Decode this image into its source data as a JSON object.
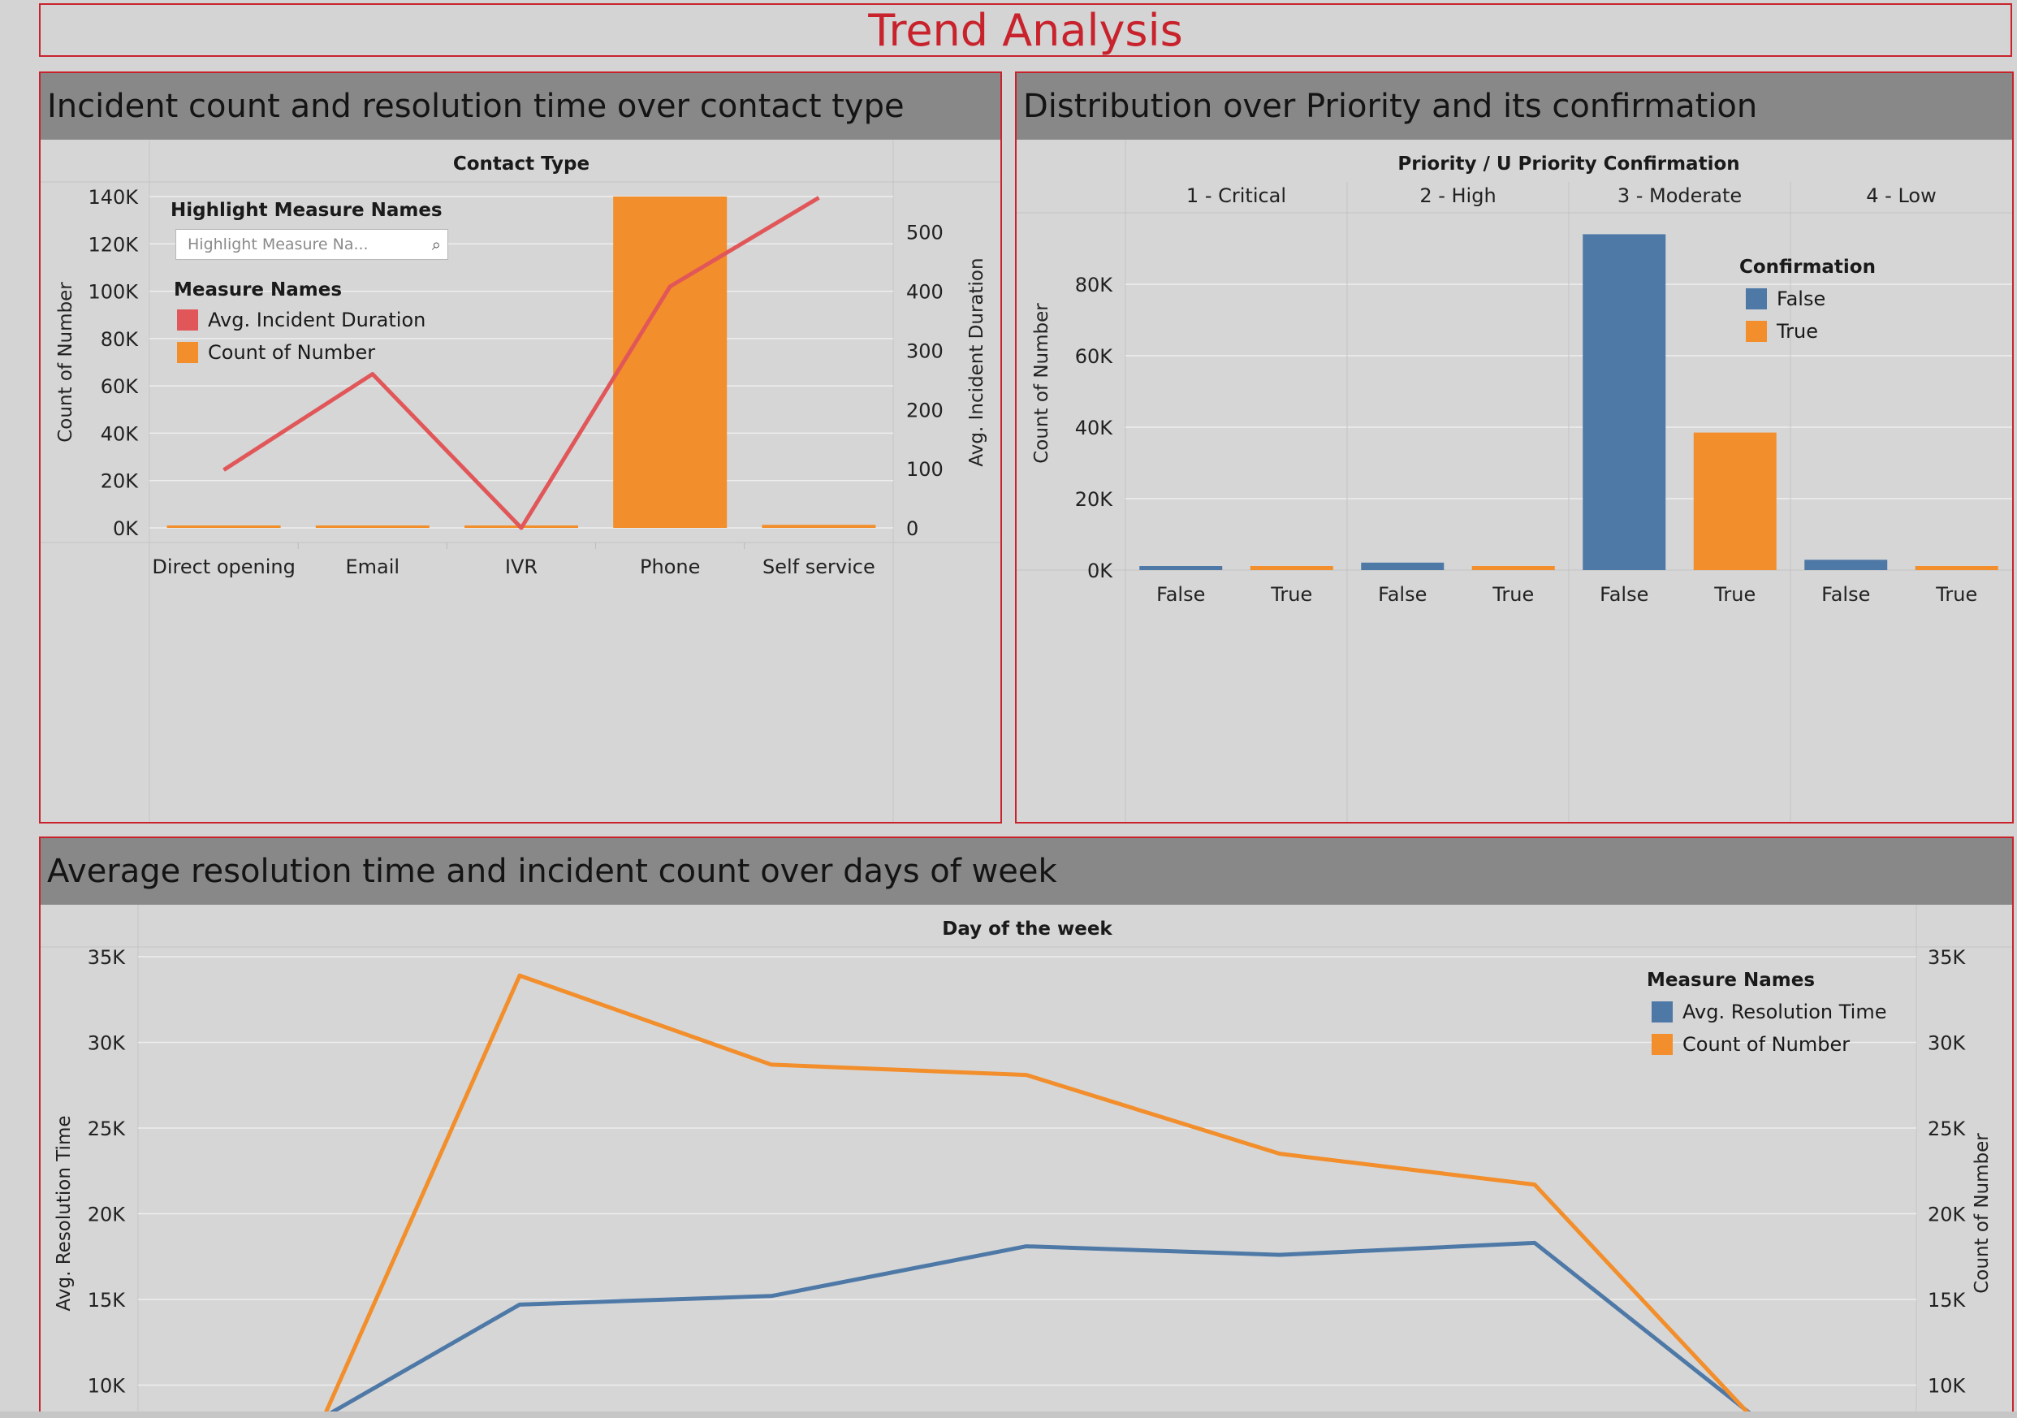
{
  "dashboard": {
    "title": "Trend Analysis"
  },
  "panels": {
    "contact": {
      "title": "Incident count and resolution time over contact type",
      "highlight_title": "Highlight Measure Names",
      "highlight_placeholder": "Highlight Measure Na...",
      "legend_title": "Measure Names",
      "legend": [
        {
          "label": "Avg. Incident Duration",
          "color": "#e15759"
        },
        {
          "label": "Count of Number",
          "color": "#f28e2b"
        }
      ]
    },
    "priority": {
      "title": "Distribution over Priority and its confirmation",
      "legend_title": "Confirmation",
      "legend": [
        {
          "label": "False",
          "color": "#4e79a7"
        },
        {
          "label": "True",
          "color": "#f28e2b"
        }
      ]
    },
    "weekday": {
      "title": "Average resolution time and incident count over days of week",
      "legend_title": "Measure Names",
      "legend": [
        {
          "label": "Avg. Resolution Time",
          "color": "#4e79a7"
        },
        {
          "label": "Count of Number",
          "color": "#f28e2b"
        }
      ]
    }
  },
  "chart_data": [
    {
      "type": "bar+line",
      "header": "Contact Type",
      "categories": [
        "Direct opening",
        "Email",
        "IVR",
        "Phone",
        "Self service"
      ],
      "ylabel": "Count of Number",
      "y2label": "Avg. Incident Duration",
      "ylim": [
        0,
        140000
      ],
      "y2lim": [
        0,
        560
      ],
      "yticks": [
        "0K",
        "20K",
        "40K",
        "60K",
        "80K",
        "100K",
        "120K",
        "140K"
      ],
      "y2ticks": [
        "0",
        "100",
        "200",
        "300",
        "400",
        "500"
      ],
      "series": [
        {
          "name": "Count of Number",
          "mark": "bar",
          "color": "#f28e2b",
          "values": [
            200,
            600,
            250,
            140000,
            1300
          ]
        },
        {
          "name": "Avg. Incident Duration",
          "mark": "line",
          "color": "#e15759",
          "values": [
            98,
            260,
            0,
            408,
            558
          ]
        }
      ]
    },
    {
      "type": "bar",
      "header": "Priority  /  U Priority Confirmation",
      "groups": [
        "1 - Critical",
        "2 - High",
        "3 - Moderate",
        "4 - Low"
      ],
      "subcategories": [
        "False",
        "True"
      ],
      "ylabel": "Count of Number",
      "ylim": [
        0,
        95000
      ],
      "yticks": [
        "0K",
        "20K",
        "40K",
        "60K",
        "80K"
      ],
      "series": [
        {
          "name": "False",
          "color": "#4e79a7",
          "values": [
            1100,
            2100,
            94000,
            2900
          ]
        },
        {
          "name": "True",
          "color": "#f28e2b",
          "values": [
            1000,
            700,
            38500,
            700
          ]
        }
      ]
    },
    {
      "type": "line",
      "header": "Day of the week",
      "ylabel": "Avg. Resolution Time",
      "y2label": "Count of Number",
      "ylim": [
        8000,
        35000
      ],
      "yticks": [
        "10K",
        "15K",
        "20K",
        "25K",
        "30K",
        "35K"
      ],
      "series": [
        {
          "name": "Avg. Resolution Time",
          "color": "#4e79a7",
          "values": [
            7900,
            14700,
            15200,
            18100,
            17600,
            18300,
            7800
          ]
        },
        {
          "name": "Count of Number",
          "color": "#f28e2b",
          "values": [
            7200,
            33900,
            28700,
            28100,
            23500,
            21700,
            7500
          ]
        }
      ]
    }
  ]
}
